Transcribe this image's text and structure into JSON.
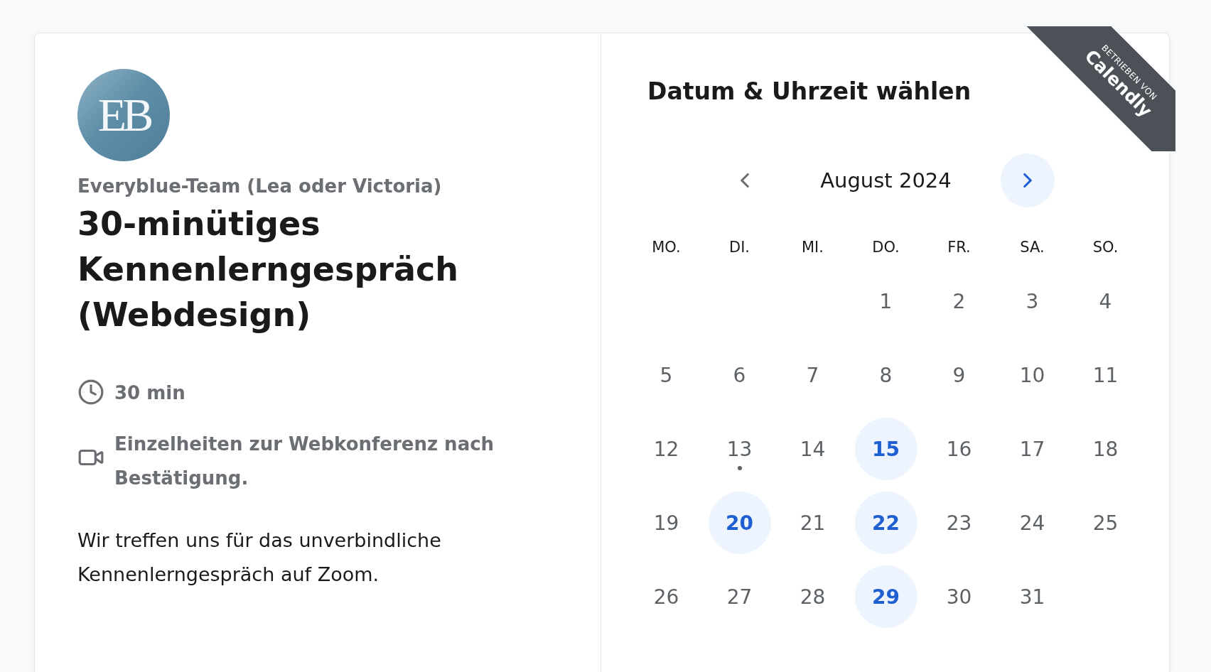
{
  "organizer": {
    "logo_text": "EB",
    "name": "Everyblue-Team (Lea oder Victoria)"
  },
  "event": {
    "title": "30-minütiges Kennenlerngespräch (Webdesign)",
    "details": [
      {
        "kind": "duration",
        "text": "30 min"
      },
      {
        "kind": "video",
        "text": "Einzelheiten zur Webkonferenz nach Bestätigung."
      }
    ],
    "description": "Wir treffen uns für das unverbindliche Kennenlerngespräch auf Zoom."
  },
  "ribbon": {
    "caption": "BETRIEBEN VON",
    "brand": "Calendly"
  },
  "calendar": {
    "heading": "Datum & Uhrzeit wählen",
    "month": "August 2024",
    "prev_enabled": false,
    "next_enabled": true,
    "weekdays": [
      "MO.",
      "DI.",
      "MI.",
      "DO.",
      "FR.",
      "SA.",
      "SO."
    ],
    "weeks": [
      {
        "kind": "leading_gap",
        "days": [
          {
            "day": "1",
            "available": false,
            "today": false
          },
          {
            "day": "2",
            "available": false,
            "today": false
          },
          {
            "day": "3",
            "available": false,
            "today": false
          },
          {
            "day": "4",
            "available": false,
            "today": false
          }
        ]
      },
      {
        "kind": "full",
        "days": [
          {
            "day": "5",
            "available": false,
            "today": false
          },
          {
            "day": "6",
            "available": false,
            "today": false
          },
          {
            "day": "7",
            "available": false,
            "today": false
          },
          {
            "day": "8",
            "available": false,
            "today": false
          },
          {
            "day": "9",
            "available": false,
            "today": false
          },
          {
            "day": "10",
            "available": false,
            "today": false
          },
          {
            "day": "11",
            "available": false,
            "today": false
          }
        ]
      },
      {
        "kind": "full",
        "days": [
          {
            "day": "12",
            "available": false,
            "today": false
          },
          {
            "day": "13",
            "available": false,
            "today": true
          },
          {
            "day": "14",
            "available": false,
            "today": false
          },
          {
            "day": "15",
            "available": true,
            "today": false
          },
          {
            "day": "16",
            "available": false,
            "today": false
          },
          {
            "day": "17",
            "available": false,
            "today": false
          },
          {
            "day": "18",
            "available": false,
            "today": false
          }
        ]
      },
      {
        "kind": "full",
        "days": [
          {
            "day": "19",
            "available": false,
            "today": false
          },
          {
            "day": "20",
            "available": true,
            "today": false
          },
          {
            "day": "21",
            "available": false,
            "today": false
          },
          {
            "day": "22",
            "available": true,
            "today": false
          },
          {
            "day": "23",
            "available": false,
            "today": false
          },
          {
            "day": "24",
            "available": false,
            "today": false
          },
          {
            "day": "25",
            "available": false,
            "today": false
          }
        ]
      },
      {
        "kind": "trailing_gap",
        "days": [
          {
            "day": "26",
            "available": false,
            "today": false
          },
          {
            "day": "27",
            "available": false,
            "today": false
          },
          {
            "day": "28",
            "available": false,
            "today": false
          },
          {
            "day": "29",
            "available": true,
            "today": false
          },
          {
            "day": "30",
            "available": false,
            "today": false
          },
          {
            "day": "31",
            "available": false,
            "today": false
          }
        ]
      }
    ]
  }
}
